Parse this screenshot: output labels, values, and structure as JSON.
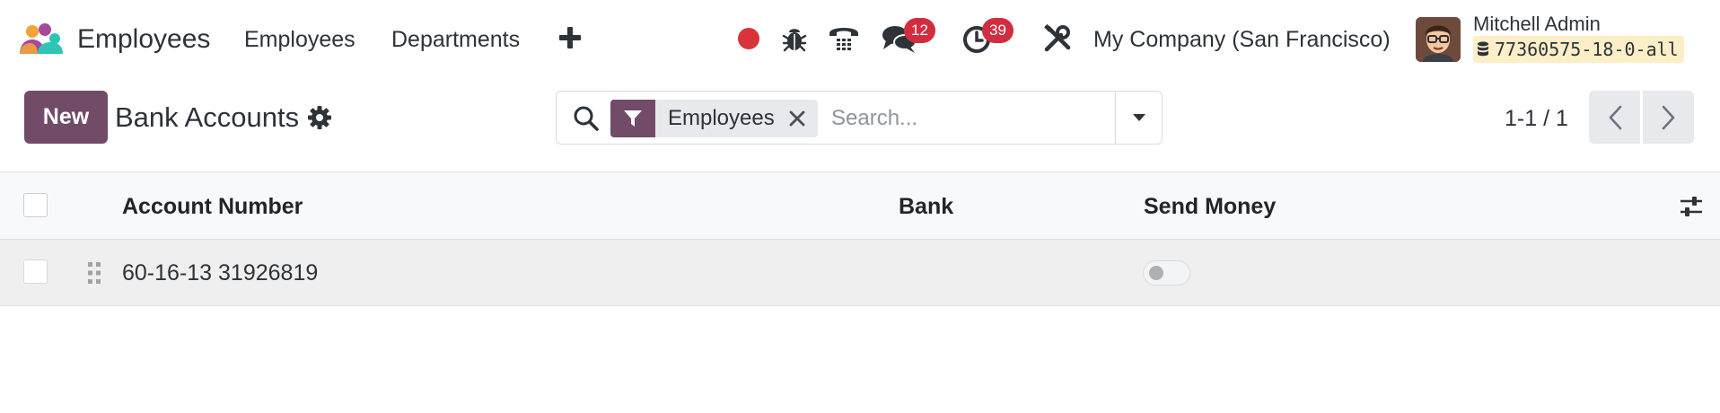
{
  "navbar": {
    "app_name": "Employees",
    "menus": [
      "Employees",
      "Departments"
    ],
    "chat_badge": "12",
    "activity_badge": "39",
    "company": "My Company (San Francisco)",
    "user_name": "Mitchell Admin",
    "database": "77360575-18-0-all"
  },
  "control_panel": {
    "new_button": "New",
    "title": "Bank Accounts",
    "search": {
      "facet_label": "Employees",
      "placeholder": "Search..."
    },
    "pager": "1-1 / 1"
  },
  "list": {
    "columns": [
      "Account Number",
      "Bank",
      "Send Money"
    ],
    "rows": [
      {
        "account_number": "60-16-13 31926819",
        "bank": "",
        "send_money": false
      }
    ]
  },
  "colors": {
    "brand": "#714b67",
    "badge": "#d22d3f",
    "record": "#d9343a"
  },
  "icons": {
    "record": "record-dot-icon",
    "debug": "bug-icon",
    "phone": "phone-icon",
    "chat": "chat-icon",
    "activity": "clock-icon",
    "tools": "tools-icon",
    "settings": "gear-icon",
    "search": "search-icon",
    "filter": "filter-icon"
  }
}
